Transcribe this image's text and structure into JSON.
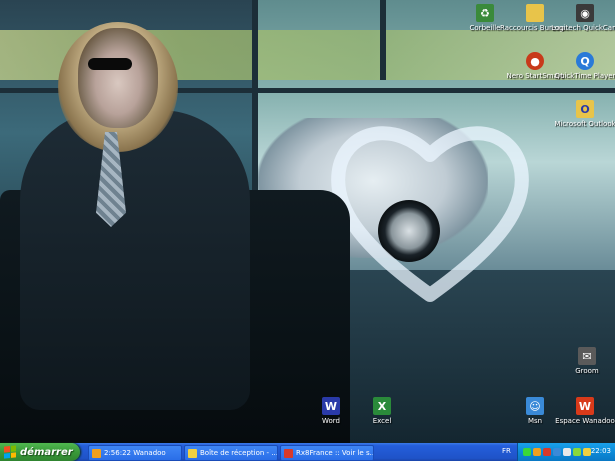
{
  "desktop": {
    "icons": [
      {
        "name": "recycle-bin-icon",
        "label": "Corbeille",
        "color": "#3a8a3a",
        "glyph": "♻"
      },
      {
        "name": "folder-icon",
        "label": "Raccourcis Bureau...",
        "color": "#e8c44a",
        "glyph": ""
      },
      {
        "name": "webcam-icon",
        "label": "Logitech QuickCam",
        "color": "#3a3a3a",
        "glyph": "◉"
      },
      {
        "name": "nero-icon",
        "label": "Nero StartSmart",
        "color": "#c83a1a",
        "glyph": "●"
      },
      {
        "name": "quicktime-icon",
        "label": "QuickTime Player",
        "color": "#2a7ad8",
        "glyph": "Q"
      },
      {
        "name": "outlook-icon",
        "label": "Microsoft Outlook",
        "color": "#e8c44a",
        "glyph": "O"
      },
      {
        "name": "groom-icon",
        "label": "Groom",
        "color": "#5a5a5a",
        "glyph": "✉"
      },
      {
        "name": "word-icon",
        "label": "Word",
        "color": "#2a3aa8",
        "glyph": "W"
      },
      {
        "name": "excel-icon",
        "label": "Excel",
        "color": "#2a8a3a",
        "glyph": "X"
      },
      {
        "name": "msn-icon",
        "label": "Msn",
        "color": "#3a8ad8",
        "glyph": "☺"
      },
      {
        "name": "wanadoo-icon",
        "label": "Espace Wanadoo",
        "color": "#d83a1a",
        "glyph": "W"
      }
    ]
  },
  "taskbar": {
    "start_label": "démarrer",
    "tasks": [
      {
        "label": "2:56:22 Wanadoo",
        "color": "#f0a020"
      },
      {
        "label": "Boîte de réception - ...",
        "color": "#f0d040"
      },
      {
        "label": "Rx8France :: Voir le s...",
        "color": "#d83a2a"
      }
    ],
    "language": "FR",
    "tray_icons": [
      "#3ad83a",
      "#f0a020",
      "#d83a2a",
      "#3a8ad8",
      "#e8e8e8",
      "#8ad83a",
      "#f0d040"
    ],
    "clock": "22:03"
  }
}
